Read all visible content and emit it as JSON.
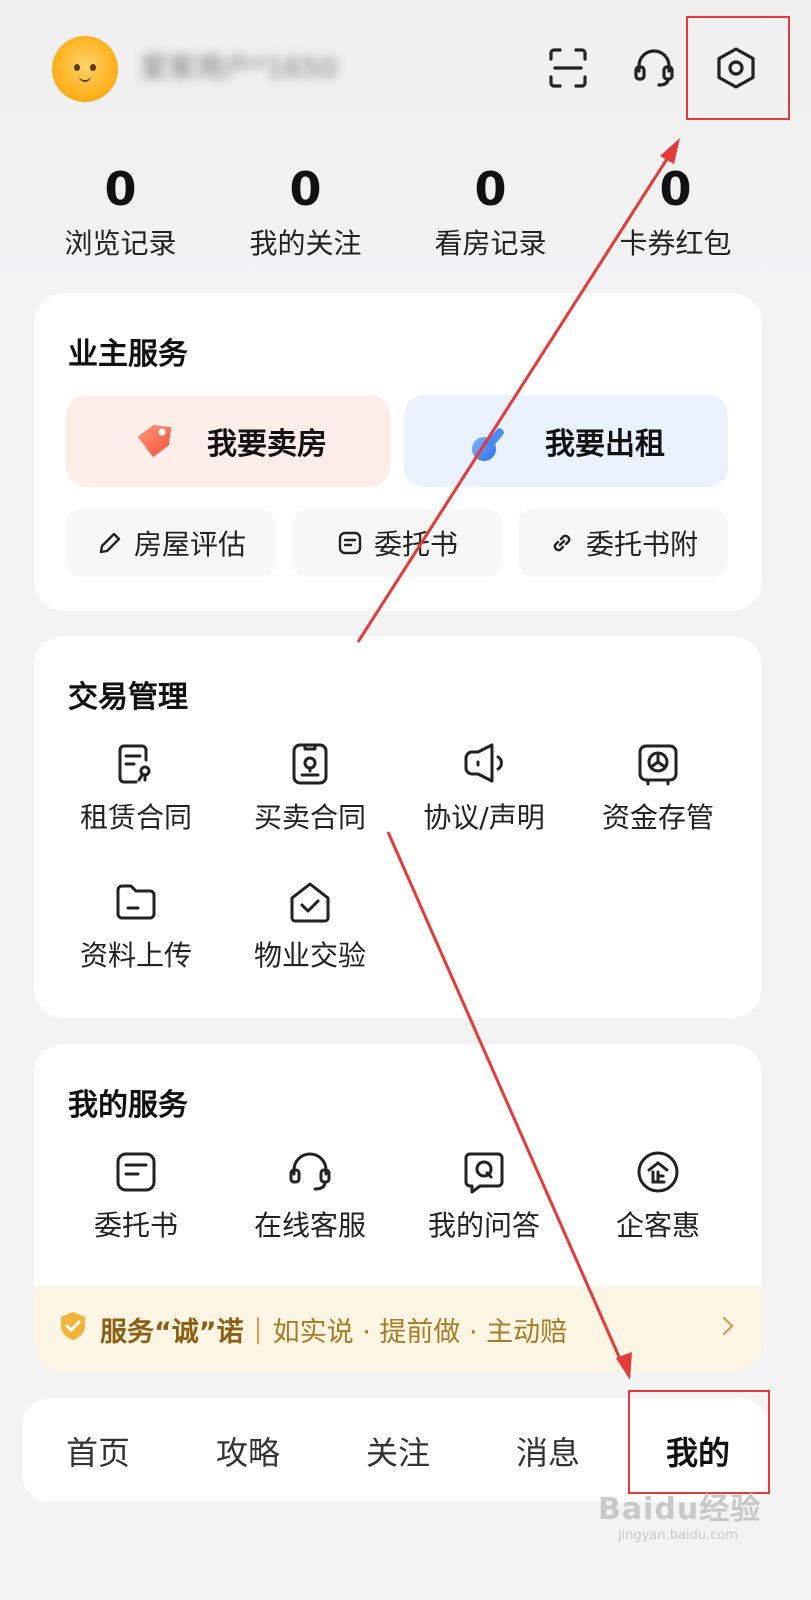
{
  "header": {
    "username": "爱家用户*1650"
  },
  "stats": [
    {
      "value": "0",
      "label": "浏览记录"
    },
    {
      "value": "0",
      "label": "我的关注"
    },
    {
      "value": "0",
      "label": "看房记录"
    },
    {
      "value": "0",
      "label": "卡券红包"
    }
  ],
  "owner_service": {
    "title": "业主服务",
    "sell_label": "我要卖房",
    "rent_label": "我要出租",
    "small": [
      {
        "label": "房屋评估",
        "icon": "pencil-icon"
      },
      {
        "label": "委托书",
        "icon": "document-icon"
      },
      {
        "label": "委托书附",
        "icon": "link-icon"
      }
    ]
  },
  "deal_management": {
    "title": "交易管理",
    "items": [
      {
        "label": "租赁合同",
        "icon": "lease-contract-icon"
      },
      {
        "label": "买卖合同",
        "icon": "sale-contract-icon"
      },
      {
        "label": "协议/声明",
        "icon": "megaphone-icon"
      },
      {
        "label": "资金存管",
        "icon": "safe-icon"
      },
      {
        "label": "资料上传",
        "icon": "folder-icon"
      },
      {
        "label": "物业交验",
        "icon": "house-check-icon"
      }
    ]
  },
  "my_service": {
    "title": "我的服务",
    "items": [
      {
        "label": "委托书",
        "icon": "document-icon"
      },
      {
        "label": "在线客服",
        "icon": "headset-icon"
      },
      {
        "label": "我的问答",
        "icon": "qa-icon"
      },
      {
        "label": "企客惠",
        "icon": "enterprise-icon"
      }
    ],
    "promise_title": "服务“诚”诺",
    "promise_text": "如实说 · 提前做 · 主动赔"
  },
  "bottom_nav": [
    {
      "label": "首页"
    },
    {
      "label": "攻略"
    },
    {
      "label": "关注"
    },
    {
      "label": "消息"
    },
    {
      "label": "我的",
      "active": true
    }
  ],
  "annotation_color": "#e43a3a",
  "watermark": {
    "logo": "Baidu经验",
    "url": "jingyan.baidu.com"
  }
}
